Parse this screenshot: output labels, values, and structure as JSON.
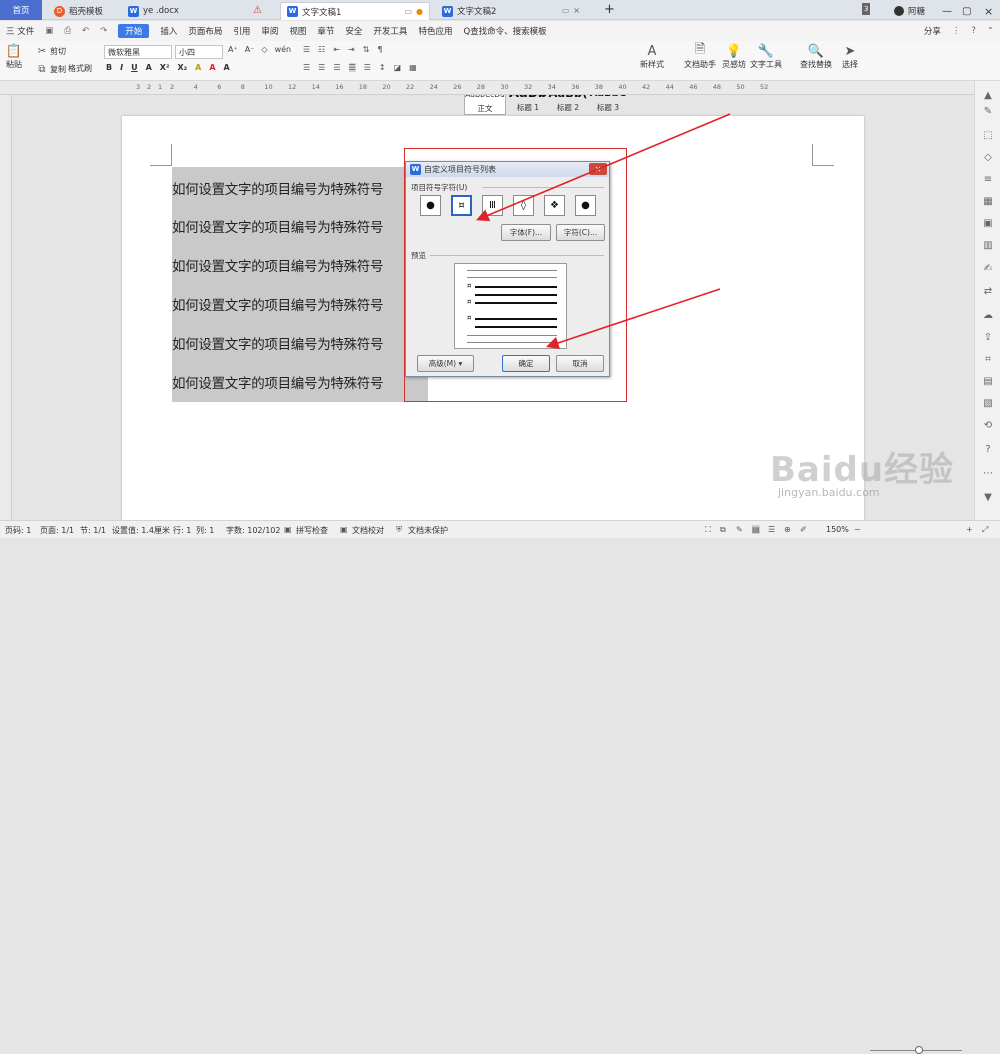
{
  "tabbar": {
    "home": "首页",
    "tabs": [
      {
        "label": "稻壳模板",
        "icon": "docer-icon"
      },
      {
        "label": "ye .docx",
        "icon": "word-doc-icon"
      },
      {
        "label": "文字文稿1",
        "icon": "word-doc-icon"
      },
      {
        "label": "文字文稿2",
        "icon": "word-doc-icon"
      }
    ],
    "add": "+",
    "count": "3",
    "user": "阿糖"
  },
  "menubar": {
    "file": "三 文件",
    "items": [
      "开始",
      "插入",
      "页面布局",
      "引用",
      "审阅",
      "视图",
      "章节",
      "安全",
      "开发工具",
      "特色应用"
    ],
    "search": "Q查找命令、搜索模板",
    "share": "分享"
  },
  "ribbon": {
    "paste": "粘贴",
    "cut": "剪切",
    "copy": "复制",
    "format_painter": "格式刷",
    "font_name": "微软雅黑",
    "font_size": "小四",
    "styles": [
      {
        "preview": "AaBbCcDd",
        "label": "正文"
      },
      {
        "preview": "AaBb",
        "label": "标题 1"
      },
      {
        "preview": "AaBb(",
        "label": "标题 2"
      },
      {
        "preview": "AaBbC",
        "label": "标题 3"
      }
    ],
    "new_style": "新样式",
    "doc_assistant": "文档助手",
    "inspiration": "灵感坊",
    "text_tools": "文字工具",
    "find_replace": "查找替换",
    "select": "选择"
  },
  "ruler": {
    "marks": [
      "3",
      "2",
      "1",
      "2",
      "4",
      "6",
      "8",
      "10",
      "12",
      "14",
      "16",
      "18",
      "20",
      "22",
      "24",
      "26",
      "28",
      "30",
      "32",
      "34",
      "36",
      "38",
      "40",
      "42",
      "44",
      "46",
      "48",
      "50",
      "52"
    ]
  },
  "document": {
    "lines": [
      "如何设置文字的项目编号为特殊符号",
      "如何设置文字的项目编号为特殊符号",
      "如何设置文字的项目编号为特殊符号",
      "如何设置文字的项目编号为特殊符号",
      "如何设置文字的项目编号为特殊符号",
      "如何设置文字的项目编号为特殊符号"
    ]
  },
  "dialog": {
    "title": "自定义项目符号列表",
    "group_label": "项目符号字符(U)",
    "bullets": [
      "●",
      "¤",
      "Ⅲ",
      "◊",
      "❖",
      "●"
    ],
    "selected_index": 1,
    "font_button": "字体(F)...",
    "char_button": "字符(C)...",
    "preview_label": "预览",
    "preview_bullet": "¤",
    "advanced_button": "高级(M) ▾",
    "ok_button": "确定",
    "cancel_button": "取消"
  },
  "statusbar": {
    "page_num": "页码: 1",
    "page": "页面: 1/1",
    "section": "节: 1/1",
    "position": "设置值: 1.4厘米",
    "row": "行: 1",
    "col": "列: 1",
    "words": "字数: 102/102",
    "spell": "拼写检查",
    "proof": "文档校对",
    "protect": "文档未保护",
    "zoom": "150%"
  },
  "watermark": {
    "brand": "Baidu经验",
    "url": "jingyan.baidu.com"
  }
}
